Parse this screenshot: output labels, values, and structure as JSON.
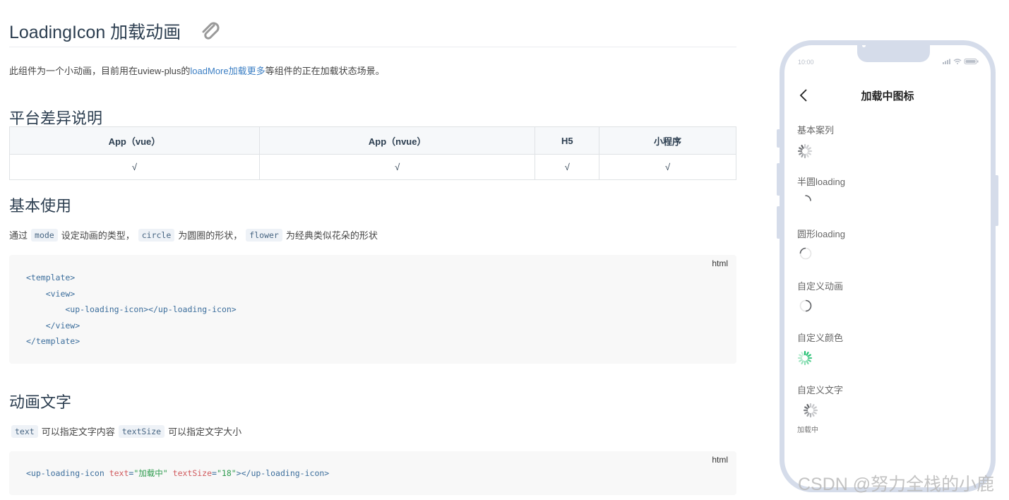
{
  "doc": {
    "title": "LoadingIcon 加载动画",
    "intro_before": "此组件为一个小动画，目前用在uview-plus的",
    "intro_link": "loadMore加载更多",
    "intro_after": "等组件的正在加载状态场景。",
    "platform_heading": "平台差异说明",
    "platform_table": {
      "headers": [
        "App（vue）",
        "App（nvue）",
        "H5",
        "小程序"
      ],
      "row": [
        "√",
        "√",
        "√",
        "√"
      ]
    },
    "basic_heading": "基本使用",
    "basic_text": {
      "p1": "通过",
      "code1": "mode",
      "p2": "设定动画的类型，",
      "code2": "circle",
      "p3": "为圆圈的形状，",
      "code3": "flower",
      "p4": "为经典类似花朵的形状"
    },
    "code1": {
      "lang": "html",
      "lines": [
        "<template>",
        "    <view>",
        "        <up-loading-icon></up-loading-icon>",
        "    </view>",
        "</template>"
      ]
    },
    "anim_heading": "动画文字",
    "anim_text": {
      "code1": "text",
      "p1": "可以指定文字内容",
      "code2": "textSize",
      "p2": "可以指定文字大小"
    },
    "code2": {
      "lang": "html",
      "tag_open": "<up-loading-icon ",
      "attr1": "text",
      "eq1": "=",
      "val1": "\"加载中\"",
      "attr2": "textSize",
      "eq2": "=",
      "val2": "\"18\"",
      "tag_close": "></up-loading-icon>"
    }
  },
  "phone": {
    "status_time": "10:00",
    "nav_title": "加载中图标",
    "sections": [
      {
        "label": "基本案列",
        "icon": "flower-spinner-icon"
      },
      {
        "label": "半圆loading",
        "icon": "semicircle-spinner-icon"
      },
      {
        "label": "圆形loading",
        "icon": "circle-spinner-icon"
      },
      {
        "label": "自定义动画",
        "icon": "custom-spinner-icon"
      },
      {
        "label": "自定义颜色",
        "icon": "green-flower-spinner-icon"
      },
      {
        "label": "自定义文字",
        "icon": "flower-spinner-icon"
      }
    ],
    "loading_text": "加载中",
    "custom_color": "#19be6b"
  },
  "watermark": "CSDN @努力全栈的小鹿"
}
